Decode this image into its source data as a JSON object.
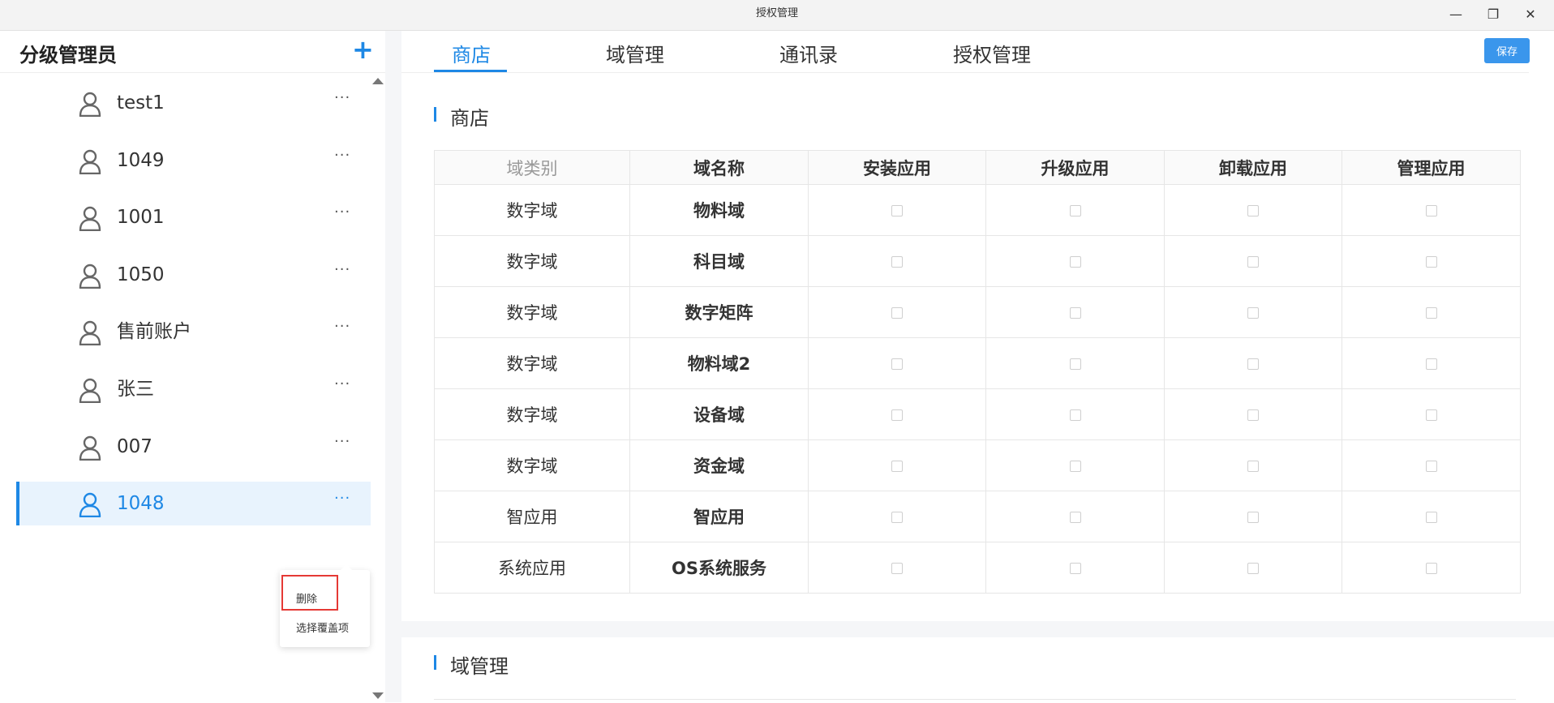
{
  "window": {
    "title": "授权管理",
    "min_icon": "—",
    "max_icon": "❐",
    "close_icon": "✕"
  },
  "sidebar": {
    "title": "分级管理员",
    "add_icon": "+",
    "more_icon": "···",
    "items": [
      {
        "label": "test1"
      },
      {
        "label": "1049"
      },
      {
        "label": "1001"
      },
      {
        "label": "1050"
      },
      {
        "label": "售前账户"
      },
      {
        "label": "张三"
      },
      {
        "label": "007"
      },
      {
        "label": "1048",
        "active": true
      }
    ],
    "context_menu": {
      "items": [
        {
          "label": "删除"
        },
        {
          "label": "选择覆盖项"
        }
      ]
    }
  },
  "main": {
    "tabs": [
      {
        "label": "商店"
      },
      {
        "label": "域管理"
      },
      {
        "label": "通讯录"
      },
      {
        "label": "授权管理"
      }
    ],
    "active_tab": "商店",
    "save_label": "保存",
    "sections": [
      {
        "title": "商店"
      },
      {
        "title": "域管理"
      }
    ],
    "table": {
      "headers": [
        "域类别",
        "域名称",
        "安装应用",
        "升级应用",
        "卸载应用",
        "管理应用"
      ],
      "rows": [
        {
          "category": "数字域",
          "name": "物料域"
        },
        {
          "category": "数字域",
          "name": "科目域"
        },
        {
          "category": "数字域",
          "name": "数字矩阵"
        },
        {
          "category": "数字域",
          "name": "物料域2"
        },
        {
          "category": "数字域",
          "name": "设备域"
        },
        {
          "category": "数字域",
          "name": "资金域"
        },
        {
          "category": "智应用",
          "name": "智应用"
        },
        {
          "category": "系统应用",
          "name": "OS系统服务"
        }
      ]
    }
  },
  "colors": {
    "accent": "#1e88e5",
    "highlight_box": "#e53935",
    "active_row_bg": "#e8f3fd"
  }
}
